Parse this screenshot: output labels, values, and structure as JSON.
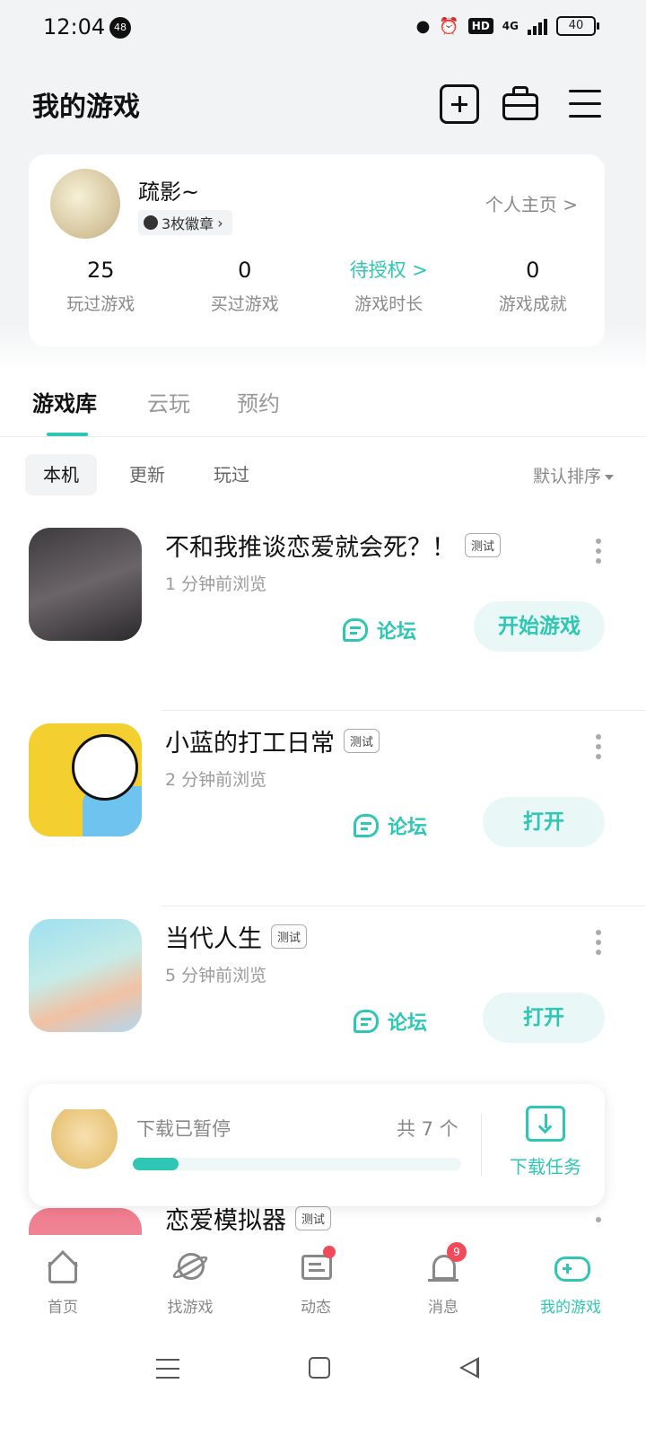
{
  "status_bar": {
    "time": "12:04",
    "notification_count": "48",
    "network": "4G",
    "hd": "HD",
    "battery": "40"
  },
  "header": {
    "title": "我的游戏"
  },
  "profile": {
    "username": "疏影~",
    "medals": "3枚徽章",
    "homepage_link": "个人主页 >",
    "stats": [
      {
        "value": "25",
        "label": "玩过游戏"
      },
      {
        "value": "0",
        "label": "买过游戏"
      },
      {
        "value": "待授权 >",
        "label": "游戏时长"
      },
      {
        "value": "0",
        "label": "游戏成就"
      }
    ]
  },
  "tabs": [
    {
      "label": "游戏库",
      "active": true
    },
    {
      "label": "云玩",
      "active": false
    },
    {
      "label": "预约",
      "active": false
    }
  ],
  "filters": {
    "chips": [
      {
        "label": "本机",
        "active": true
      },
      {
        "label": "更新",
        "active": false
      },
      {
        "label": "玩过",
        "active": false
      }
    ],
    "sort_label": "默认排序"
  },
  "games": [
    {
      "title": "不和我推谈恋爱就会死？！",
      "tag": "测试",
      "subtitle": "1 分钟前浏览",
      "forum": "论坛",
      "action": "开始游戏"
    },
    {
      "title": "小蓝的打工日常",
      "tag": "测试",
      "subtitle": "2 分钟前浏览",
      "forum": "论坛",
      "action": "打开"
    },
    {
      "title": "当代人生",
      "tag": "测试",
      "subtitle": "5 分钟前浏览",
      "forum": "论坛",
      "action": "打开"
    },
    {
      "title": "恋爱模拟器",
      "tag": "测试",
      "subtitle": "",
      "forum": "",
      "action": ""
    }
  ],
  "download": {
    "status": "下载已暂停",
    "count": "共 7 个",
    "progress": 0.14,
    "task_label": "下载任务"
  },
  "bottom_nav": [
    {
      "label": "首页",
      "icon": "home-icon"
    },
    {
      "label": "找游戏",
      "icon": "planet-icon"
    },
    {
      "label": "动态",
      "icon": "chat-icon"
    },
    {
      "label": "消息",
      "icon": "bell-icon",
      "badge": "9"
    },
    {
      "label": "我的游戏",
      "icon": "gamepad-icon",
      "active": true
    }
  ],
  "colors": {
    "accent": "#2fc7b4",
    "background": "#f2f3f5",
    "badge_red": "#f04b5b"
  }
}
